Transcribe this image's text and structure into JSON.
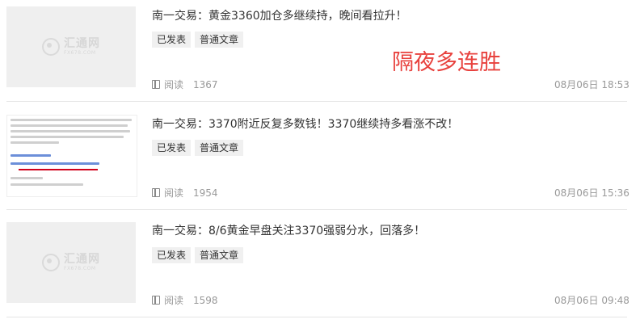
{
  "annotation": "隔夜多连胜",
  "logo": {
    "cn": "汇通网",
    "en": "FX678.COM"
  },
  "articles": [
    {
      "title": "南一交易：黄金3360加仓多继续持，晚间看拉升！",
      "tags": [
        "已发表",
        "普通文章"
      ],
      "read_label": "阅读",
      "views": "1367",
      "date": "08月06日 18:53",
      "thumb": "logo"
    },
    {
      "title": "南一交易：3370附近反复多数钱！3370继续持多看涨不改！",
      "tags": [
        "已发表",
        "普通文章"
      ],
      "read_label": "阅读",
      "views": "1954",
      "date": "08月06日 15:36",
      "thumb": "doc"
    },
    {
      "title": "南一交易：8/6黄金早盘关注3370强弱分水，回落多！",
      "tags": [
        "已发表",
        "普通文章"
      ],
      "read_label": "阅读",
      "views": "1598",
      "date": "08月06日 09:48",
      "thumb": "logo"
    }
  ]
}
